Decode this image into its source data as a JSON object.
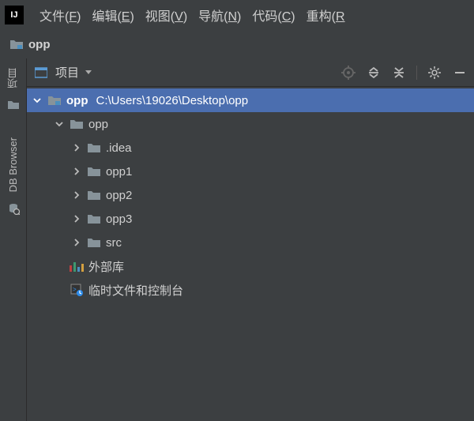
{
  "menubar": {
    "items": [
      {
        "pre": "文件(",
        "key": "F",
        "post": ")"
      },
      {
        "pre": "编辑(",
        "key": "E",
        "post": ")"
      },
      {
        "pre": "视图(",
        "key": "V",
        "post": ")"
      },
      {
        "pre": "导航(",
        "key": "N",
        "post": ")"
      },
      {
        "pre": "代码(",
        "key": "C",
        "post": ")"
      },
      {
        "pre": "重构(",
        "key": "R",
        "post": "..."
      }
    ]
  },
  "breadcrumb": {
    "project": "opp"
  },
  "sidebar": {
    "tabs": [
      {
        "label": "项目",
        "icon": "project"
      },
      {
        "label": "DB Browser",
        "icon": "db"
      }
    ]
  },
  "panel": {
    "title": "项目"
  },
  "tree": {
    "root": {
      "name": "opp",
      "path": "C:\\Users\\19026\\Desktop\\opp"
    },
    "nodes": [
      {
        "indent": 1,
        "expand": "down",
        "icon": "folder-gray",
        "label": "opp"
      },
      {
        "indent": 2,
        "expand": "right",
        "icon": "folder-gray",
        "label": ".idea"
      },
      {
        "indent": 2,
        "expand": "right",
        "icon": "folder-gray",
        "label": "opp1"
      },
      {
        "indent": 2,
        "expand": "right",
        "icon": "folder-gray",
        "label": "opp2"
      },
      {
        "indent": 2,
        "expand": "right",
        "icon": "folder-gray",
        "label": "opp3"
      },
      {
        "indent": 2,
        "expand": "right",
        "icon": "folder-gray",
        "label": "src"
      }
    ],
    "external_lib": "外部库",
    "scratch": "临时文件和控制台"
  }
}
